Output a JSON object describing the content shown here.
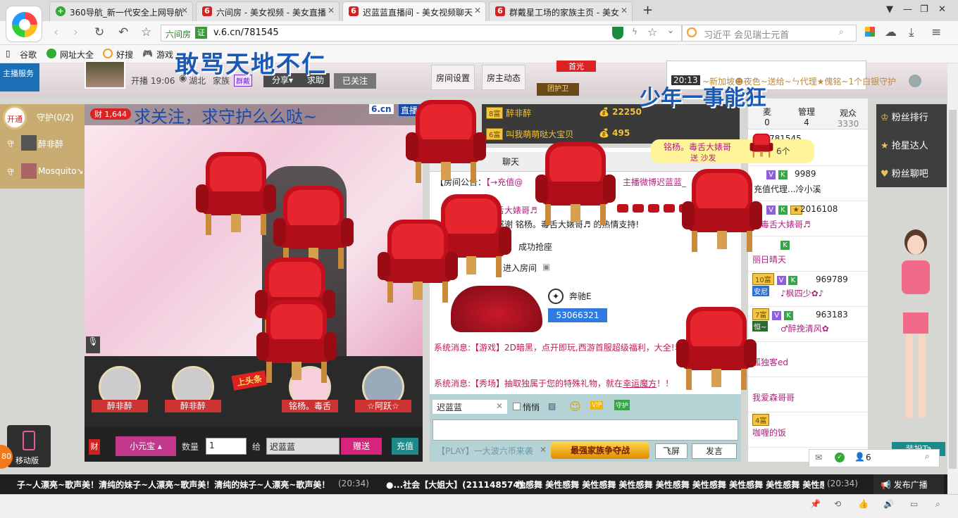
{
  "browser": {
    "tabs": [
      {
        "title": "360导航_新一代安全上网导航"
      },
      {
        "title": "六间房 - 美女视频 - 美女直播"
      },
      {
        "title": "迟蓝蓝直播间 - 美女视频聊天"
      },
      {
        "title": "群戴星工场的家族主页 - 美女"
      }
    ],
    "new_tab": "+",
    "url_site": "六间房",
    "url_badge": "证",
    "url": "v.6.cn/781545",
    "search_text": "习近平 会见瑞士元首",
    "bookmarks": [
      "谷歌",
      "网址大全",
      "好搜",
      "游戏"
    ],
    "left_badge_number": "80"
  },
  "room": {
    "overlay_title": "敢骂天地不仁",
    "overlay_slogan": "少年一事能狂",
    "anchor_start_time": "开播 19:06",
    "anchor_location": "湖北",
    "anchor_family": "家族",
    "family_tag": "群戴",
    "share_label": "分享",
    "help_label": "求助",
    "followed_label": "已关注",
    "room_settings": "房间设置",
    "host_activity": "房主动态",
    "host_rank_tag": "首光",
    "team_guard": "团护卫",
    "service_label": "主播服务",
    "video_wealth": "1,644",
    "video_caption": "求关注，求守护么么哒~",
    "video_brand": "6.cn",
    "video_live": "直播"
  },
  "guard": {
    "open_label": "开通",
    "title": "守护(0/2)",
    "members": [
      "醉非醉",
      "Mosquito↘"
    ]
  },
  "top_fans": [
    {
      "rank": "8富",
      "name": "醉非醉",
      "coins": "22250"
    },
    {
      "rank": "6富",
      "name": "叫我萌萌哒大宝贝",
      "coins": "495"
    }
  ],
  "top_notices": [
    {
      "time": "20:13",
      "text": "~新加坡☻夜色~送给~ㄣ代理★傀铭~1个白银守护"
    }
  ],
  "seat_banner": {
    "names": "铭杨。毒舌大婊哥",
    "action": "送 沙发",
    "count": "6个"
  },
  "chat": {
    "tabs": [
      "聊天"
    ],
    "announcement_label": "【房间公告：",
    "announcement_text": "【→充值@",
    "announcement_right": "主播微博迟蓝蓝_",
    "message_rows": [
      "舌大婊哥♬",
      "感谢 铭杨。毒舌大婊哥♬ 的热情支持!",
      "成功抢座",
      "进入房间"
    ],
    "car_name": "奔驰E",
    "car_id": "53066321",
    "system_msg_1": "系统消息:【游戏】2D暗黑，点开即玩,西游首服超级福利，大全!幸!",
    "system_msg_2_label": "系统消息:",
    "system_msg_2": "【秀场】抽取独属于您的特殊礼物，就在",
    "system_msg_2_link": "幸运魔方",
    "system_msg_2_end": "！！"
  },
  "chat_input": {
    "target": "迟蓝蓝",
    "whisper": "悄悄",
    "promo": "【PLAY】一大波六币来袭",
    "battle_btn": "最强家族争夺战",
    "fly_btn": "飞屏",
    "send_btn": "发言"
  },
  "gift_bar": {
    "gift_name": "小元宝",
    "quantity_label": "数量",
    "quantity_value": "1",
    "to_label": "给",
    "to_value": "迟蓝蓝",
    "give_btn": "赠送",
    "recharge_btn": "充值",
    "wealth_icon": "财"
  },
  "guests": [
    {
      "name": "醉非醉"
    },
    {
      "name": "醉非醉"
    },
    {
      "name": "铭杨。毒舌"
    },
    {
      "name": "☆阿跃☆"
    }
  ],
  "top_seat_label": "上头条",
  "user_list": {
    "tabs": [
      {
        "label": "麦",
        "count": "0"
      },
      {
        "label": "管理",
        "count": "4"
      },
      {
        "label": "观众",
        "count": "3330"
      }
    ],
    "rows": [
      {
        "id": "781545",
        "name": ""
      },
      {
        "id": "9989",
        "name": "充值代理...冷小溪"
      },
      {
        "id": "2016108",
        "name": "。毒舌大婊哥♬"
      },
      {
        "id": "",
        "name": "丽日晴天"
      },
      {
        "id": "969789",
        "name": "♪枫四少✿♪",
        "rank": "10富",
        "tag": "安尼"
      },
      {
        "id": "963183",
        "name": "♂醉挽清风✿",
        "rank": "7富",
        "tag": "恒~"
      },
      {
        "id": "",
        "name": "孤独客ed"
      },
      {
        "id": "",
        "name": "我爱森哥哥"
      },
      {
        "id": "",
        "name": "咖喱的饭",
        "rank": "4富"
      },
      {
        "id": "",
        "name": ""
      }
    ]
  },
  "right_nav": [
    "粉丝排行",
    "抢星达人",
    "粉丝聊吧"
  ],
  "avatar_label": "装扮Ta",
  "online_count": "6",
  "mobile_label": "移动版",
  "ticker": {
    "msg_1": "子~人漂亮~歌声美！清纯的妹子~人漂亮~歌声美！清纯的妹子~人漂亮~歌声美！",
    "time_1": "(20:34)",
    "msg_2_prefix": "●...社会【大姐大】(211148574):",
    "msg_2": "性感舞 美性感舞 美性感舞 美性感舞 美性感舞 美性感舞 美性感舞 美性感舞 美性感舞 美",
    "time_2": "(20:34)",
    "publish_btn": "发布广播"
  }
}
